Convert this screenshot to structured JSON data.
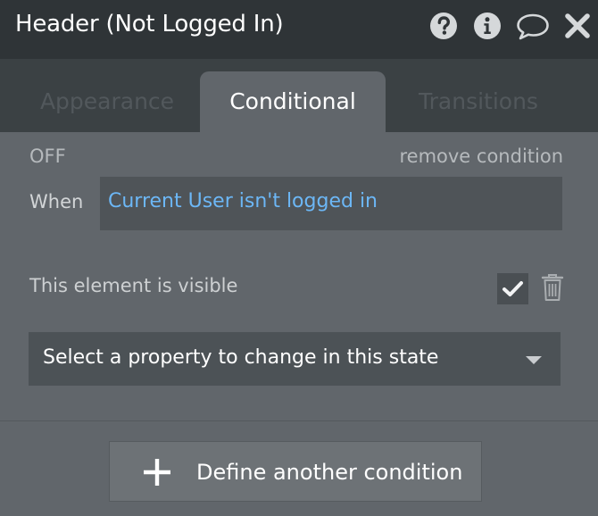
{
  "window": {
    "title": "Header (Not Logged In)",
    "icons": [
      "help-icon",
      "info-icon",
      "comment-icon",
      "close-icon"
    ]
  },
  "tabs": [
    {
      "label": "Appearance",
      "active": false
    },
    {
      "label": "Conditional",
      "active": true
    },
    {
      "label": "Transitions",
      "active": false
    }
  ],
  "condition": {
    "state_label": "OFF",
    "remove_label": "remove condition",
    "when_label": "When",
    "expression": "Current User isn't logged in",
    "expression_color": "#6cb7f6",
    "property_label": "This element is visible",
    "property_checked": true,
    "select_placeholder": "Select a property to change in this state"
  },
  "footer": {
    "define_label": "Define another condition"
  },
  "colors": {
    "titlebar": "#2f3437",
    "tabbar": "#3b4144",
    "panel": "#61666b"
  }
}
